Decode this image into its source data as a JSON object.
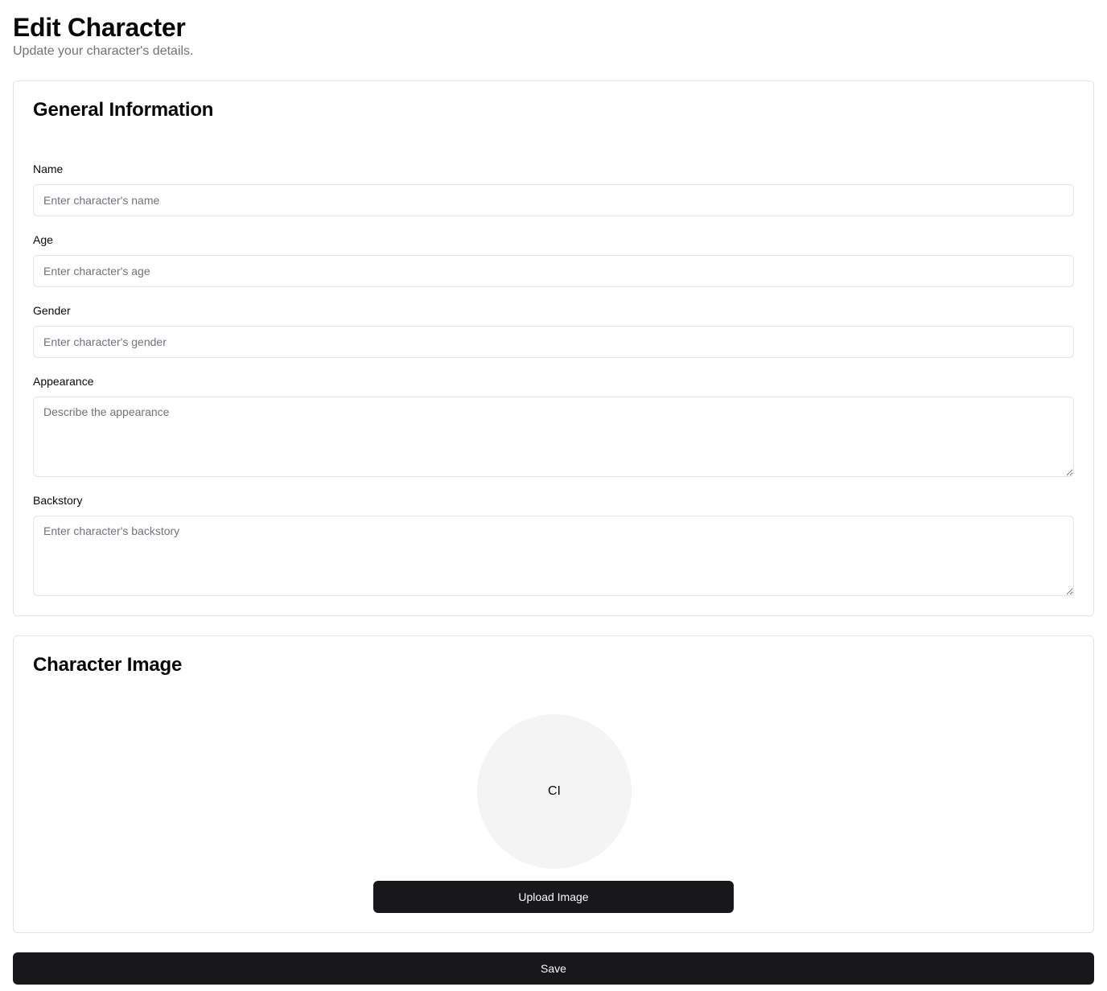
{
  "header": {
    "title": "Edit Character",
    "subtitle": "Update your character's details."
  },
  "general": {
    "title": "General Information",
    "fields": {
      "name": {
        "label": "Name",
        "placeholder": "Enter character's name",
        "value": ""
      },
      "age": {
        "label": "Age",
        "placeholder": "Enter character's age",
        "value": ""
      },
      "gender": {
        "label": "Gender",
        "placeholder": "Enter character's gender",
        "value": ""
      },
      "appearance": {
        "label": "Appearance",
        "placeholder": "Describe the appearance",
        "value": ""
      },
      "backstory": {
        "label": "Backstory",
        "placeholder": "Enter character's backstory",
        "value": ""
      }
    }
  },
  "image_section": {
    "title": "Character Image",
    "avatar_initials": "CI",
    "upload_label": "Upload Image"
  },
  "actions": {
    "save_label": "Save"
  },
  "colors": {
    "primary": "#18181b",
    "border": "#e4e4e7",
    "muted_text": "#71717a",
    "avatar_bg": "#f4f4f5"
  }
}
